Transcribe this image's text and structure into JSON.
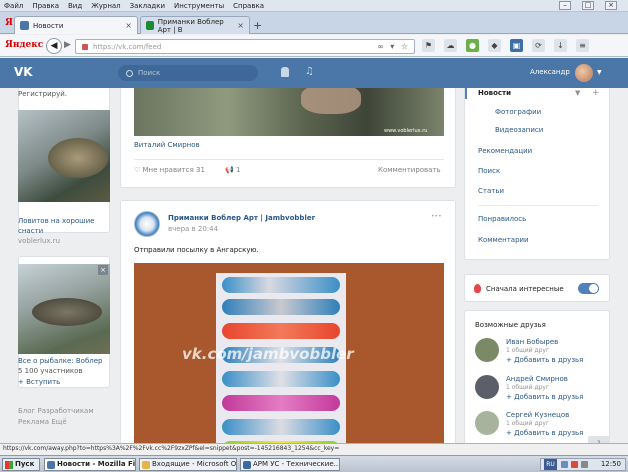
{
  "menu": [
    "Файл",
    "Правка",
    "Вид",
    "Журнал",
    "Закладки",
    "Инструменты",
    "Справка"
  ],
  "tabs": [
    {
      "label": "Новости",
      "active": true,
      "favicon_color": "#4a76a8"
    },
    {
      "label": "Приманки Воблер Арт | В",
      "active": false,
      "favicon_color": "#1c8a2e"
    }
  ],
  "browser": {
    "logo": "Яндекс",
    "url": "https://vk.com/feed",
    "tab_logo": "Я"
  },
  "vk": {
    "logo": "VK",
    "search_placeholder": "Поиск",
    "user_name": "Александр"
  },
  "left": {
    "register": "Регистрируй.",
    "ad1_title": "Ловитов на хорошие снасти",
    "ad1_site": "voblerlux.ru",
    "ad2_title": "Все о рыбалке: Воблер",
    "ad2_sub": "5 100 участников",
    "ad2_join": "+ Вступить",
    "footer": [
      "Блог",
      "Разработчикам",
      "Реклама",
      "Ещё"
    ]
  },
  "post1": {
    "photo_caption": "www.voblerlux.ru",
    "author": "Виталий Смирнов",
    "likes_label": "Мне нравится",
    "likes": "31",
    "reposts": "1",
    "comment_label": "Комментировать"
  },
  "post2": {
    "group": "Приманки Воблер Арт | Jambvobbler",
    "date": "вчера в 20:44",
    "text": "Отправили посылку в Ангарскую.",
    "watermark": "vk.com/jambvobbler"
  },
  "right_menu": {
    "items": [
      {
        "label": "Новости",
        "active": true
      },
      {
        "label": "Фотографии",
        "sub": true
      },
      {
        "label": "Видеозаписи",
        "sub": true
      },
      {
        "label": "Рекомендации"
      },
      {
        "label": "Поиск"
      },
      {
        "label": "Статьи"
      },
      {
        "label": "Понравилось"
      },
      {
        "label": "Комментарии"
      }
    ],
    "interesting_label": "Сначала интересные",
    "friends_title": "Возможные друзья",
    "friends": [
      {
        "name": "Иван Бобырев",
        "mutual": "1 общий друг",
        "add": "+ Добавить в друзья",
        "color": "#7b8a66"
      },
      {
        "name": "Андрей Смирнов",
        "mutual": "1 общий друг",
        "add": "+ Добавить в друзья",
        "color": "#5c5e6a"
      },
      {
        "name": "Сергей Кузнецов",
        "mutual": "1 общий друг",
        "add": "+ Добавить в друзья",
        "color": "#a7b39c"
      }
    ]
  },
  "statusbar": "https://vk.com/away.php?to=https%3A%2F%2Fvk.cc%2F9zxZPf&el=snippet&post=-145216843_1254&cc_key=",
  "taskbar": {
    "start": "Пуск",
    "tasks": [
      {
        "label": "Новости - Mozilla Fire...",
        "active": true,
        "color": "#4a76a8"
      },
      {
        "label": "Входящие - Microsoft Outlook",
        "active": false,
        "color": "#e3b447"
      },
      {
        "label": "АРМ УС - Технические...",
        "active": false,
        "color": "#3b6aa0"
      }
    ],
    "lang": "RU",
    "clock": "12:50"
  },
  "scroll_label": "1"
}
